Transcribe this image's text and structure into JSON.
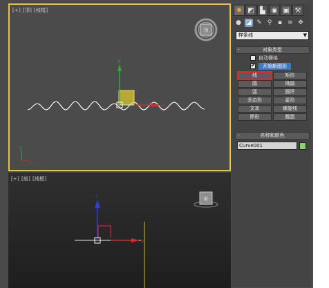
{
  "viewports": {
    "top": {
      "label_parts": [
        "[+]",
        "[顶]",
        "[线框]"
      ]
    },
    "front": {
      "label_parts": [
        "[+]",
        "[前]",
        "[线框]"
      ]
    }
  },
  "command_panel": {
    "main_tabs": [
      {
        "icon": "create-icon",
        "glyph": "✹"
      },
      {
        "icon": "modify-icon",
        "glyph": "◩"
      },
      {
        "icon": "hierarchy-icon",
        "glyph": "▙"
      },
      {
        "icon": "motion-icon",
        "glyph": "◉"
      },
      {
        "icon": "display-icon",
        "glyph": "▣"
      },
      {
        "icon": "utilities-icon",
        "glyph": "⚒"
      }
    ],
    "sub_tabs": [
      {
        "icon": "geometry-icon",
        "glyph": "●"
      },
      {
        "icon": "shapes-icon",
        "glyph": "◪"
      },
      {
        "icon": "lights-icon",
        "glyph": "✎"
      },
      {
        "icon": "cameras-icon",
        "glyph": "⚲"
      },
      {
        "icon": "helpers-icon",
        "glyph": "▪"
      },
      {
        "icon": "spacewarps-icon",
        "glyph": "≋"
      },
      {
        "icon": "systems-icon",
        "glyph": "✥"
      }
    ],
    "category_dropdown": {
      "value": "样条线"
    },
    "object_type": {
      "header": "对象类型",
      "auto_grid_label": "自动栅格",
      "start_new_shape_label": "开始新图形",
      "buttons": [
        "线",
        "矩形",
        "圆",
        "椭圆",
        "弧",
        "圆环",
        "多边形",
        "星形",
        "文本",
        "螺旋线",
        "卵形",
        "截面"
      ]
    },
    "name_color": {
      "header": "名称和颜色",
      "name_value": "Curve001",
      "swatch_color": "#86d36f"
    }
  },
  "colors": {
    "active_viewport_border": "#e6c43c",
    "axis_x": "#d42a2a",
    "axis_y": "#2db12d",
    "axis_z": "#2c3fd8",
    "highlight_box": "#e4252b"
  }
}
